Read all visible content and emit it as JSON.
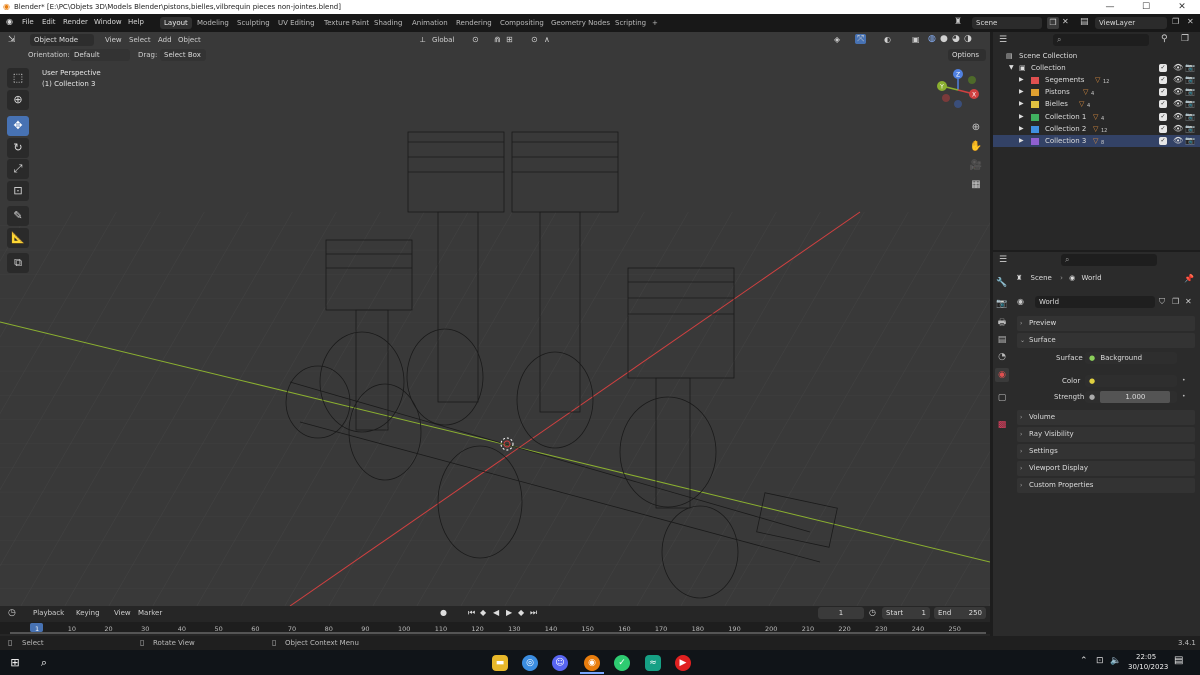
{
  "window": {
    "title": "Blender* [E:\\PC\\Objets 3D\\Models Blender\\pistons,bielles,vilbrequin pieces non-jointes.blend]",
    "min_icon": "minimize-icon",
    "max_icon": "maximize-icon",
    "close_icon": "close-icon"
  },
  "menubar": {
    "items": [
      "File",
      "Edit",
      "Render",
      "Window",
      "Help"
    ],
    "workspaces": [
      "Layout",
      "Modeling",
      "Sculpting",
      "UV Editing",
      "Texture Paint",
      "Shading",
      "Animation",
      "Rendering",
      "Compositing",
      "Geometry Nodes",
      "Scripting"
    ],
    "active_workspace": "Layout",
    "add_workspace": "+",
    "scene_label": "Scene",
    "viewlayer_label": "ViewLayer"
  },
  "viewport_header": {
    "mode": "Object Mode",
    "menus": [
      "View",
      "Select",
      "Add",
      "Object"
    ],
    "transform_orientation": "Global",
    "orientation_label": "Orientation:",
    "orientation_value": "Default",
    "drag_label": "Drag:",
    "drag_value": "Select Box",
    "options": "Options"
  },
  "viewport": {
    "perspective": "User Perspective",
    "collection": "(1) Collection 3",
    "gizmo": {
      "x": "X",
      "y": "Y",
      "z": "Z"
    }
  },
  "toolbar": {
    "tools": [
      "select-box-icon",
      "cursor-icon",
      "move-icon",
      "rotate-icon",
      "scale-icon",
      "transform-icon",
      "annotate-icon",
      "measure-icon",
      "add-cube-icon"
    ]
  },
  "outliner": {
    "search_placeholder": "",
    "scene_collection": "Scene Collection",
    "collection": "Collection",
    "items": [
      {
        "name": "Segements",
        "color": "#e05050",
        "count": "12"
      },
      {
        "name": "Pistons",
        "color": "#e0a030",
        "count": "4"
      },
      {
        "name": "Bielles",
        "color": "#e0c040",
        "count": "4"
      },
      {
        "name": "Collection 1",
        "color": "#40b060",
        "count": "4"
      },
      {
        "name": "Collection 2",
        "color": "#4090e0",
        "count": "12"
      },
      {
        "name": "Collection 3",
        "color": "#9060d0",
        "count": "8"
      }
    ]
  },
  "properties": {
    "breadcrumb_scene": "Scene",
    "breadcrumb_world": "World",
    "world_name": "World",
    "sections": [
      "Preview",
      "Surface",
      "Volume",
      "Ray Visibility",
      "Settings",
      "Viewport Display",
      "Custom Properties"
    ],
    "surface_label": "Surface",
    "surface_value": "Background",
    "color_label": "Color",
    "strength_label": "Strength",
    "strength_value": "1.000"
  },
  "timeline": {
    "menus": [
      "Playback",
      "Keying",
      "View",
      "Marker"
    ],
    "current_frame": "1",
    "start_label": "Start",
    "start_value": "1",
    "end_label": "End",
    "end_value": "250",
    "ticks": [
      "1",
      "10",
      "20",
      "30",
      "40",
      "50",
      "60",
      "70",
      "80",
      "90",
      "100",
      "110",
      "120",
      "130",
      "140",
      "150",
      "160",
      "170",
      "180",
      "190",
      "200",
      "210",
      "220",
      "230",
      "240",
      "250"
    ]
  },
  "statusbar": {
    "select": "Select",
    "rotate": "Rotate View",
    "context": "Object Context Menu",
    "version": "3.4.1"
  },
  "taskbar": {
    "time": "22:05",
    "date": "30/10/2023"
  },
  "colors": {
    "accent": "#4772b3",
    "viewport_bg": "#393939",
    "x_axis": "#d04040",
    "y_axis": "#8bb030"
  }
}
